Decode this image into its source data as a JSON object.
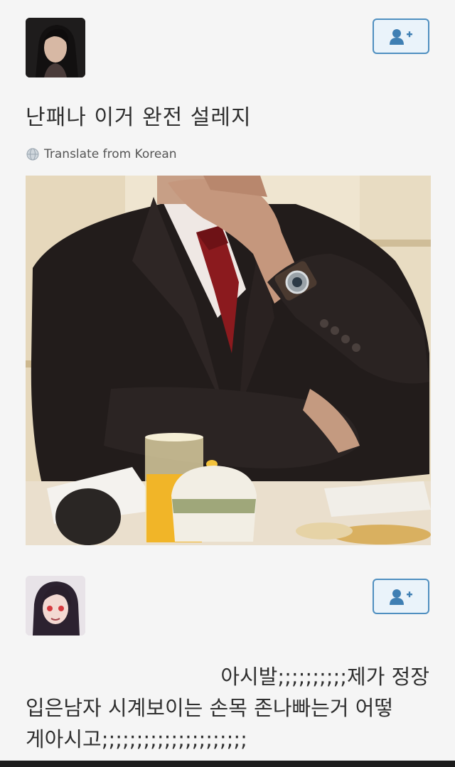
{
  "post": {
    "text": "난패나 이거 완전 설레지",
    "translate_label": "Translate from Korean"
  },
  "reply": {
    "line1": "아시발;;;;;;;;;;제가 정장",
    "line2": "입은남자 시계보이는 손목 존나빠는거 어떻",
    "line3": "게아시고;;;;;;;;;;;;;;;;;;;;;"
  },
  "icons": {
    "follow": "add-user-icon",
    "globe": "globe-icon"
  },
  "colors": {
    "follow_accent": "#4f8fc0",
    "tie": "#8b1a1e",
    "suit": "#231d1c"
  }
}
